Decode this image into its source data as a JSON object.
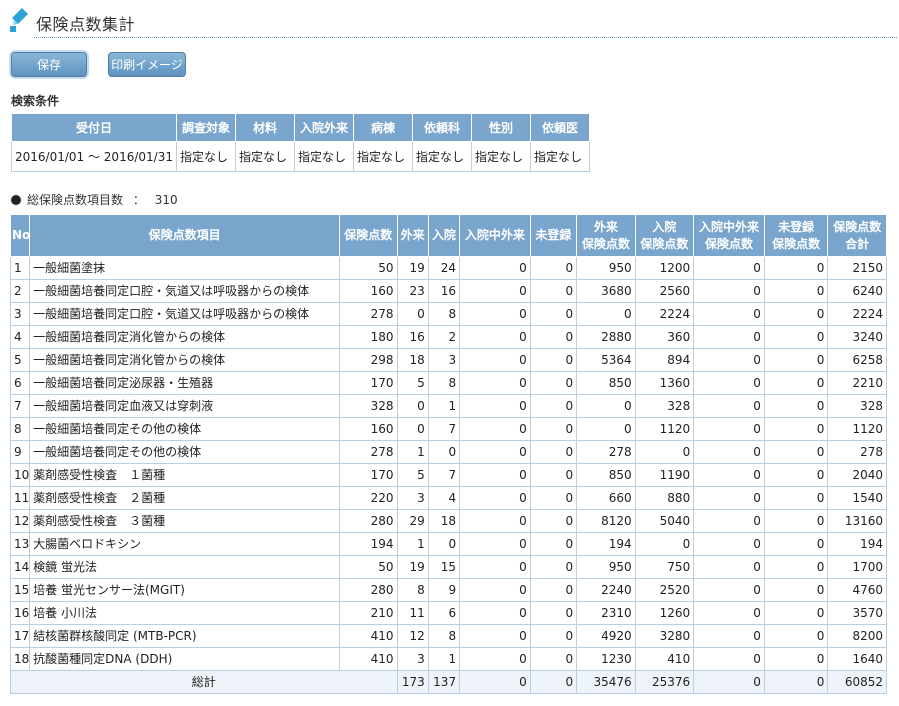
{
  "page": {
    "title": "保険点数集計"
  },
  "buttons": {
    "save": "保存",
    "print": "印刷イメージ"
  },
  "search": {
    "label": "検索条件",
    "headers": [
      "受付日",
      "調査対象",
      "材料",
      "入院外来",
      "病棟",
      "依頼科",
      "性別",
      "依頼医"
    ],
    "values": [
      "2016/01/01 ～ 2016/01/31",
      "指定なし",
      "指定なし",
      "指定なし",
      "指定なし",
      "指定なし",
      "指定なし",
      "指定なし"
    ]
  },
  "summary": {
    "label": "総保険点数項目数",
    "separator": "：",
    "value": "310"
  },
  "table": {
    "headers": [
      {
        "l1": "No",
        "l2": ""
      },
      {
        "l1": "保険点数項目",
        "l2": ""
      },
      {
        "l1": "保険点数",
        "l2": ""
      },
      {
        "l1": "外来",
        "l2": ""
      },
      {
        "l1": "入院",
        "l2": ""
      },
      {
        "l1": "入院中外来",
        "l2": ""
      },
      {
        "l1": "未登録",
        "l2": ""
      },
      {
        "l1": "外来",
        "l2": "保険点数"
      },
      {
        "l1": "入院",
        "l2": "保険点数"
      },
      {
        "l1": "入院中外来",
        "l2": "保険点数"
      },
      {
        "l1": "未登録",
        "l2": "保険点数"
      },
      {
        "l1": "保険点数",
        "l2": "合計"
      }
    ],
    "rows": [
      [
        "1",
        "一般細菌塗抹",
        "50",
        "19",
        "24",
        "0",
        "0",
        "950",
        "1200",
        "0",
        "0",
        "2150"
      ],
      [
        "2",
        "一般細菌培養同定口腔・気道又は呼吸器からの検体",
        "160",
        "23",
        "16",
        "0",
        "0",
        "3680",
        "2560",
        "0",
        "0",
        "6240"
      ],
      [
        "3",
        "一般細菌培養同定口腔・気道又は呼吸器からの検体",
        "278",
        "0",
        "8",
        "0",
        "0",
        "0",
        "2224",
        "0",
        "0",
        "2224"
      ],
      [
        "4",
        "一般細菌培養同定消化管からの検体",
        "180",
        "16",
        "2",
        "0",
        "0",
        "2880",
        "360",
        "0",
        "0",
        "3240"
      ],
      [
        "5",
        "一般細菌培養同定消化管からの検体",
        "298",
        "18",
        "3",
        "0",
        "0",
        "5364",
        "894",
        "0",
        "0",
        "6258"
      ],
      [
        "6",
        "一般細菌培養同定泌尿器・生殖器",
        "170",
        "5",
        "8",
        "0",
        "0",
        "850",
        "1360",
        "0",
        "0",
        "2210"
      ],
      [
        "7",
        "一般細菌培養同定血液又は穿刺液",
        "328",
        "0",
        "1",
        "0",
        "0",
        "0",
        "328",
        "0",
        "0",
        "328"
      ],
      [
        "8",
        "一般細菌培養同定その他の検体",
        "160",
        "0",
        "7",
        "0",
        "0",
        "0",
        "1120",
        "0",
        "0",
        "1120"
      ],
      [
        "9",
        "一般細菌培養同定その他の検体",
        "278",
        "1",
        "0",
        "0",
        "0",
        "278",
        "0",
        "0",
        "0",
        "278"
      ],
      [
        "10",
        "薬剤感受性検査　１菌種",
        "170",
        "5",
        "7",
        "0",
        "0",
        "850",
        "1190",
        "0",
        "0",
        "2040"
      ],
      [
        "11",
        "薬剤感受性検査　２菌種",
        "220",
        "3",
        "4",
        "0",
        "0",
        "660",
        "880",
        "0",
        "0",
        "1540"
      ],
      [
        "12",
        "薬剤感受性検査　３菌種",
        "280",
        "29",
        "18",
        "0",
        "0",
        "8120",
        "5040",
        "0",
        "0",
        "13160"
      ],
      [
        "13",
        "大腸菌ベロドキシン",
        "194",
        "1",
        "0",
        "0",
        "0",
        "194",
        "0",
        "0",
        "0",
        "194"
      ],
      [
        "14",
        "検鏡 蛍光法",
        "50",
        "19",
        "15",
        "0",
        "0",
        "950",
        "750",
        "0",
        "0",
        "1700"
      ],
      [
        "15",
        "培養 蛍光センサー法(MGIT)",
        "280",
        "8",
        "9",
        "0",
        "0",
        "2240",
        "2520",
        "0",
        "0",
        "4760"
      ],
      [
        "16",
        "培養 小川法",
        "210",
        "11",
        "6",
        "0",
        "0",
        "2310",
        "1260",
        "0",
        "0",
        "3570"
      ],
      [
        "17",
        "結核菌群核酸同定 (MTB-PCR)",
        "410",
        "12",
        "8",
        "0",
        "0",
        "4920",
        "3280",
        "0",
        "0",
        "8200"
      ],
      [
        "18",
        "抗酸菌種同定DNA (DDH)",
        "410",
        "3",
        "1",
        "0",
        "0",
        "1230",
        "410",
        "0",
        "0",
        "1640"
      ]
    ],
    "total": {
      "label": "総計",
      "values": [
        "173",
        "137",
        "0",
        "0",
        "35476",
        "25376",
        "0",
        "0",
        "60852"
      ]
    }
  },
  "colors": {
    "header_bg": "#7aa6cd",
    "border": "#b9cfe3",
    "button": "#6a9cc6",
    "accent": "#2aa3d9"
  }
}
